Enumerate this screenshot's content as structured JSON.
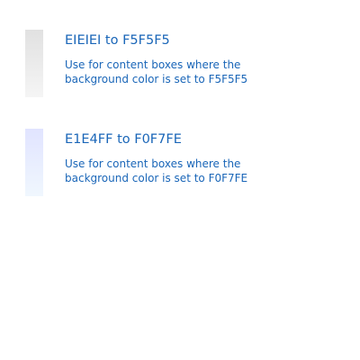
{
  "text_color": "#1A66B8",
  "swatches": [
    {
      "title": "EIEIEI to F5F5F5",
      "description": "Use for content boxes where the background color is set to F5F5F5",
      "gradient_from": "#E1E1E1",
      "gradient_to": "#F5F5F5"
    },
    {
      "title": "E1E4FF to F0F7FE",
      "description": "Use for content boxes where the background color is set to F0F7FE",
      "gradient_from": "#E1E4FF",
      "gradient_to": "#F0F7FE"
    }
  ]
}
